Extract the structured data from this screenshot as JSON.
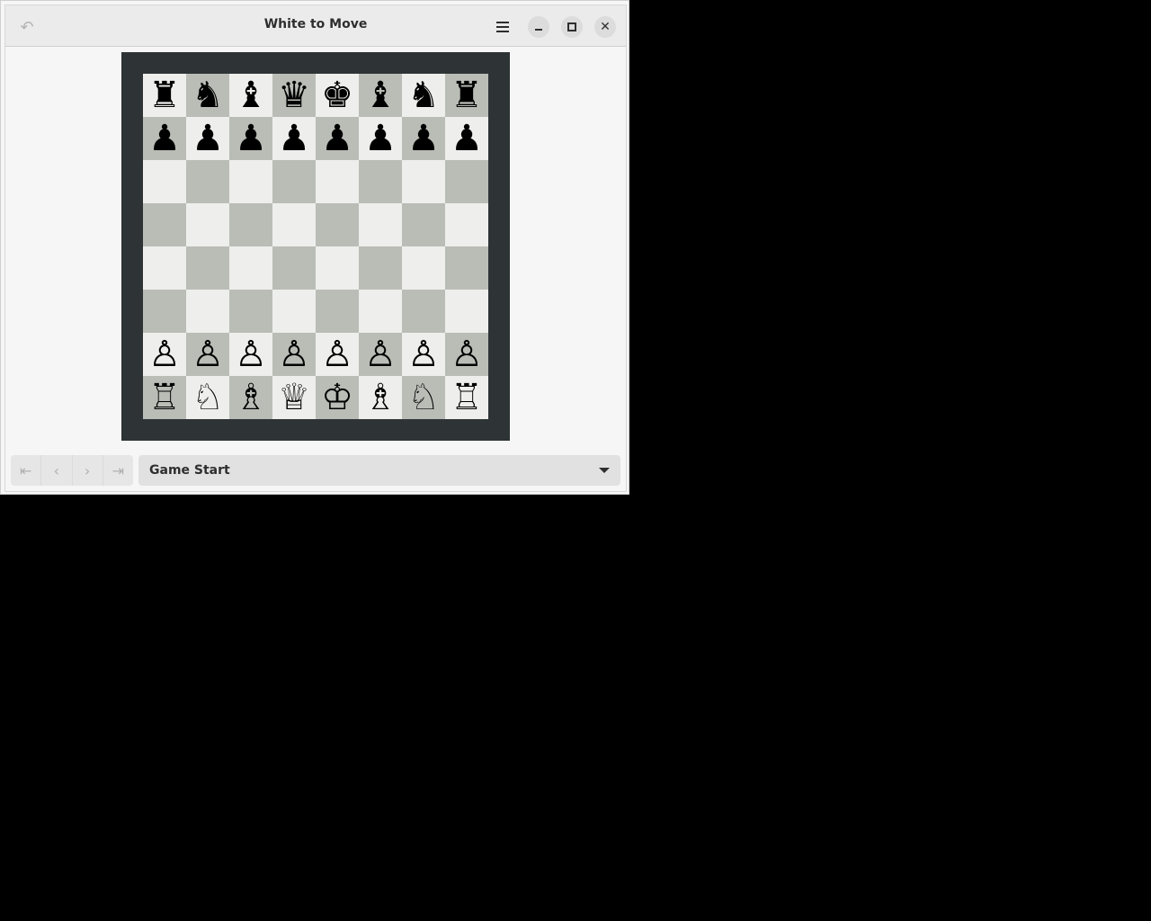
{
  "window": {
    "title": "White to Move"
  },
  "headerbar": {
    "undo_icon": "undo-icon",
    "menu_icon": "hamburger-menu-icon",
    "minimize_icon": "minimize-icon",
    "maximize_icon": "maximize-icon",
    "close_icon": "close-icon"
  },
  "board": {
    "light_color": "#eeeeec",
    "dark_color": "#babdb6",
    "frame_color": "#2e3436",
    "ranks": [
      [
        "♜",
        "♞",
        "♝",
        "♛",
        "♚",
        "♝",
        "♞",
        "♜"
      ],
      [
        "♟",
        "♟",
        "♟",
        "♟",
        "♟",
        "♟",
        "♟",
        "♟"
      ],
      [
        "",
        "",
        "",
        "",
        "",
        "",
        "",
        ""
      ],
      [
        "",
        "",
        "",
        "",
        "",
        "",
        "",
        ""
      ],
      [
        "",
        "",
        "",
        "",
        "",
        "",
        "",
        ""
      ],
      [
        "",
        "",
        "",
        "",
        "",
        "",
        "",
        ""
      ],
      [
        "♙",
        "♙",
        "♙",
        "♙",
        "♙",
        "♙",
        "♙",
        "♙"
      ],
      [
        "♖",
        "♘",
        "♗",
        "♕",
        "♔",
        "♗",
        "♘",
        "♖"
      ]
    ]
  },
  "navigation": {
    "first_icon": "first-move-icon",
    "prev_icon": "previous-move-icon",
    "next_icon": "next-move-icon",
    "last_icon": "last-move-icon"
  },
  "history": {
    "selected": "Game Start"
  }
}
